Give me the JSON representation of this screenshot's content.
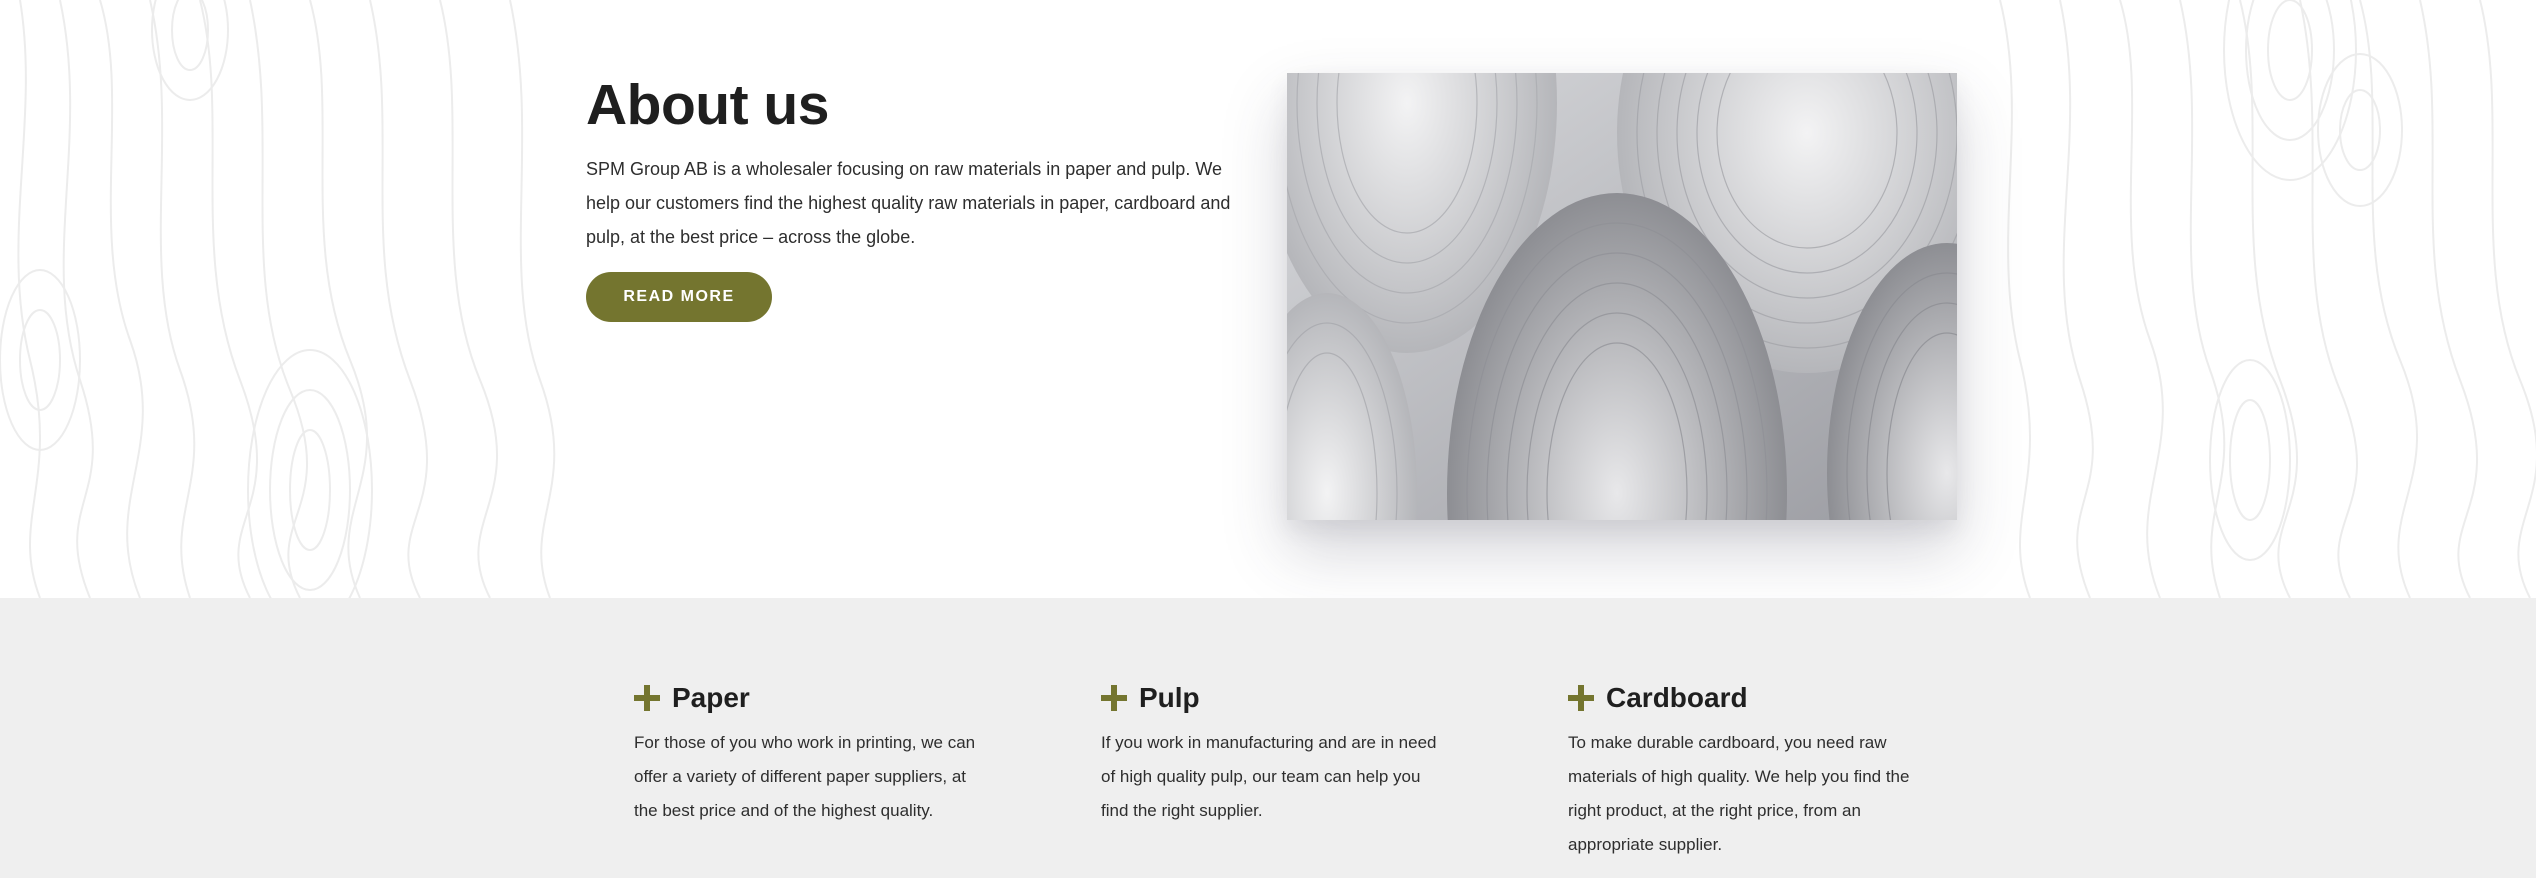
{
  "about": {
    "title": "About us",
    "body": "SPM Group AB is a wholesaler focusing on raw materials in paper and pulp. We help our customers find the highest quality raw materials in paper, cardboard and pulp, at the best price – across the globe.",
    "button_label": "READ MORE",
    "image_icon": "paper-rolls-photo"
  },
  "services": [
    {
      "icon": "plus-icon",
      "title": "Paper",
      "text": "For those of you who work in printing, we can offer a variety of different paper suppliers, at the best price and of the highest quality."
    },
    {
      "icon": "plus-icon",
      "title": "Pulp",
      "text": "If you work in manufacturing and are in need of high quality pulp, our team can help you find the right supplier."
    },
    {
      "icon": "plus-icon",
      "title": "Cardboard",
      "text": "To make durable cardboard, you need raw materials of high quality. We help you find the right product, at the right price, from an appropriate supplier."
    }
  ],
  "colors": {
    "accent": "#74752f",
    "services_bg": "#efefef",
    "heading": "#1f1f1f",
    "text": "#2e2e2e"
  }
}
